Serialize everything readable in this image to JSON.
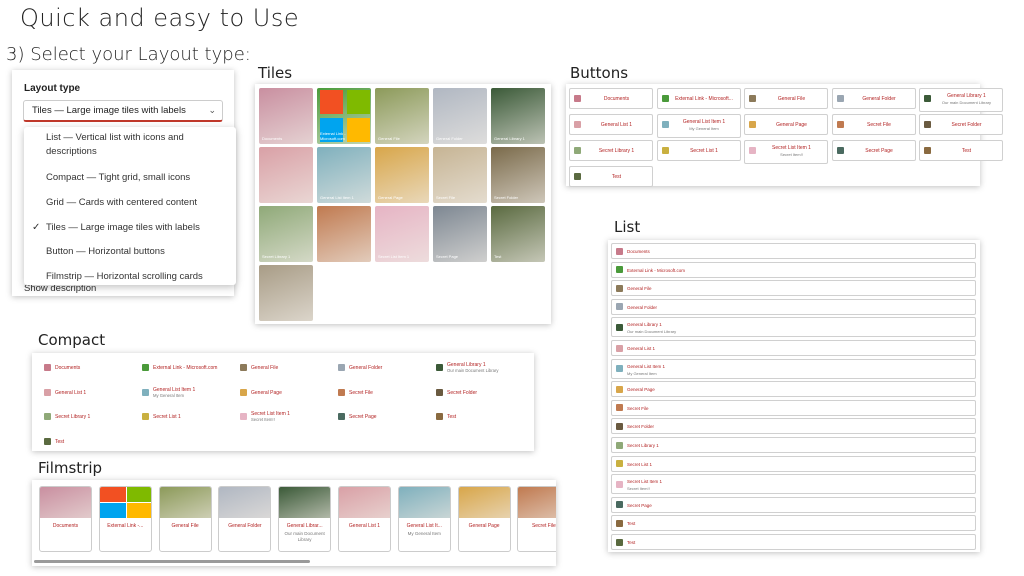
{
  "main_title": "Quick and easy to Use",
  "step_title": "3) Select your Layout type:",
  "dropdown": {
    "label": "Layout type",
    "selected": "Tiles — Large image tiles with labels",
    "options": [
      {
        "label": "List — Vertical list with icons and",
        "label2": "descriptions",
        "checked": false
      },
      {
        "label": "Compact — Tight grid, small icons",
        "checked": false
      },
      {
        "label": "Grid — Cards with centered content",
        "checked": false
      },
      {
        "label": "Tiles — Large image tiles with labels",
        "checked": true
      },
      {
        "label": "Button — Horizontal buttons",
        "checked": false
      },
      {
        "label": "Filmstrip — Horizontal scrolling cards",
        "checked": false
      }
    ],
    "check_glyph": "✓",
    "behind_text": "Show description"
  },
  "tiles": {
    "label": "Tiles",
    "items": [
      {
        "caption": "Documents",
        "color": "#c98fa0"
      },
      {
        "caption": "External Link - Microsoft.com",
        "color": "#4a9a3a"
      },
      {
        "caption": "General File",
        "color": "#8c9a5a"
      },
      {
        "caption": "General Folder",
        "color": "#b0b7c2"
      },
      {
        "caption": "General Library 1",
        "color": "#3b5a38"
      },
      {
        "caption": "",
        "color": "#d9a0a6"
      },
      {
        "caption": "General List Item 1",
        "color": "#7fb0bd"
      },
      {
        "caption": "General Page",
        "color": "#d8a64a"
      },
      {
        "caption": "Secret File",
        "color": "#c6b494"
      },
      {
        "caption": "Secret Folder",
        "color": "#7a6a4a"
      },
      {
        "caption": "Secret Library 1",
        "color": "#8fa978"
      },
      {
        "caption": "",
        "color": "#c07a50"
      },
      {
        "caption": "Secret List Item 1",
        "color": "#e6b4c4"
      },
      {
        "caption": "Secret Page",
        "color": "#7d8792"
      },
      {
        "caption": "Test",
        "color": "#5a6a40"
      },
      {
        "caption": "",
        "color": "#a89c86"
      }
    ]
  },
  "buttons": {
    "label": "Buttons",
    "items": [
      {
        "text": "Documents",
        "sub": "",
        "icon": "#c77a8a"
      },
      {
        "text": "External Link - Microsoft...",
        "sub": "",
        "icon": "#4a9a3a"
      },
      {
        "text": "General File",
        "sub": "",
        "icon": "#8c7a5a"
      },
      {
        "text": "General Folder",
        "sub": "",
        "icon": "#9aa6b2"
      },
      {
        "text": "General Library 1",
        "sub": "Our main Document Library",
        "icon": "#3b5a38"
      },
      {
        "text": "General List 1",
        "sub": "",
        "icon": "#d9a0a6"
      },
      {
        "text": "General List Item 1",
        "sub": "My General Item",
        "icon": "#7fb0bd"
      },
      {
        "text": "General Page",
        "sub": "",
        "icon": "#d8a64a"
      },
      {
        "text": "Secret File",
        "sub": "",
        "icon": "#c07a50"
      },
      {
        "text": "Secret Folder",
        "sub": "",
        "icon": "#6a5a40"
      },
      {
        "text": "Secret Library 1",
        "sub": "",
        "icon": "#8fa978"
      },
      {
        "text": "Secret List 1",
        "sub": "",
        "icon": "#c9b040"
      },
      {
        "text": "Secret List Item 1",
        "sub": "Secret Item!!",
        "icon": "#e6b4c4"
      },
      {
        "text": "Secret Page",
        "sub": "",
        "icon": "#4a6a60"
      },
      {
        "text": "Test",
        "sub": "",
        "icon": "#8a6a40"
      },
      {
        "text": "Test",
        "sub": "",
        "icon": "#5a6a40"
      }
    ]
  },
  "list": {
    "label": "List",
    "items": [
      {
        "text": "Documents",
        "sub": "",
        "icon": "#c77a8a"
      },
      {
        "text": "External Link - Microsoft.com",
        "sub": "",
        "icon": "#4a9a3a"
      },
      {
        "text": "General File",
        "sub": "",
        "icon": "#8c7a5a"
      },
      {
        "text": "General Folder",
        "sub": "",
        "icon": "#9aa6b2"
      },
      {
        "text": "General Library 1",
        "sub": "Our main Document Library",
        "icon": "#3b5a38"
      },
      {
        "text": "General List 1",
        "sub": "",
        "icon": "#d9a0a6"
      },
      {
        "text": "General List Item 1",
        "sub": "My General Item",
        "icon": "#7fb0bd"
      },
      {
        "text": "General Page",
        "sub": "",
        "icon": "#d8a64a"
      },
      {
        "text": "Secret File",
        "sub": "",
        "icon": "#c07a50"
      },
      {
        "text": "Secret Folder",
        "sub": "",
        "icon": "#6a5a40"
      },
      {
        "text": "Secret Library 1",
        "sub": "",
        "icon": "#8fa978"
      },
      {
        "text": "Secret List 1",
        "sub": "",
        "icon": "#c9b040"
      },
      {
        "text": "Secret List Item 1",
        "sub": "Secret Item!!",
        "icon": "#e6b4c4"
      },
      {
        "text": "Secret Page",
        "sub": "",
        "icon": "#4a6a60"
      },
      {
        "text": "Test",
        "sub": "",
        "icon": "#8a6a40"
      },
      {
        "text": "Test",
        "sub": "",
        "icon": "#5a6a40"
      }
    ]
  },
  "compact": {
    "label": "Compact",
    "items": [
      {
        "text": "Documents",
        "sub": "",
        "icon": "#c77a8a"
      },
      {
        "text": "External Link - Microsoft.com",
        "sub": "",
        "icon": "#4a9a3a"
      },
      {
        "text": "General File",
        "sub": "",
        "icon": "#8c7a5a"
      },
      {
        "text": "General Folder",
        "sub": "",
        "icon": "#9aa6b2"
      },
      {
        "text": "General Library 1",
        "sub": "Our main Document Library",
        "icon": "#3b5a38"
      },
      {
        "text": "General List 1",
        "sub": "",
        "icon": "#d9a0a6"
      },
      {
        "text": "General List Item 1",
        "sub": "My General Item",
        "icon": "#7fb0bd"
      },
      {
        "text": "General Page",
        "sub": "",
        "icon": "#d8a64a"
      },
      {
        "text": "Secret File",
        "sub": "",
        "icon": "#c07a50"
      },
      {
        "text": "Secret Folder",
        "sub": "",
        "icon": "#6a5a40"
      },
      {
        "text": "Secret Library 1",
        "sub": "",
        "icon": "#8fa978"
      },
      {
        "text": "Secret List 1",
        "sub": "",
        "icon": "#c9b040"
      },
      {
        "text": "Secret List Item 1",
        "sub": "Secret Item!!",
        "icon": "#e6b4c4"
      },
      {
        "text": "Secret Page",
        "sub": "",
        "icon": "#4a6a60"
      },
      {
        "text": "Test",
        "sub": "",
        "icon": "#8a6a40"
      },
      {
        "text": "Test",
        "sub": "",
        "icon": "#5a6a40"
      }
    ]
  },
  "filmstrip": {
    "label": "Filmstrip",
    "items": [
      {
        "text": "Documents",
        "sub": "",
        "color": "#c98fa0"
      },
      {
        "text": "External Link -...",
        "sub": "",
        "color": "#4a9a3a"
      },
      {
        "text": "General File",
        "sub": "",
        "color": "#8c9a5a"
      },
      {
        "text": "General Folder",
        "sub": "",
        "color": "#b0b7c2"
      },
      {
        "text": "General Librar...",
        "sub": "Our main Document Library",
        "color": "#3b5a38"
      },
      {
        "text": "General List 1",
        "sub": "",
        "color": "#d9a0a6"
      },
      {
        "text": "General List It...",
        "sub": "My General Item",
        "color": "#7fb0bd"
      },
      {
        "text": "General Page",
        "sub": "",
        "color": "#d8a64a"
      },
      {
        "text": "Secret File",
        "sub": "",
        "color": "#c07a50"
      }
    ]
  }
}
